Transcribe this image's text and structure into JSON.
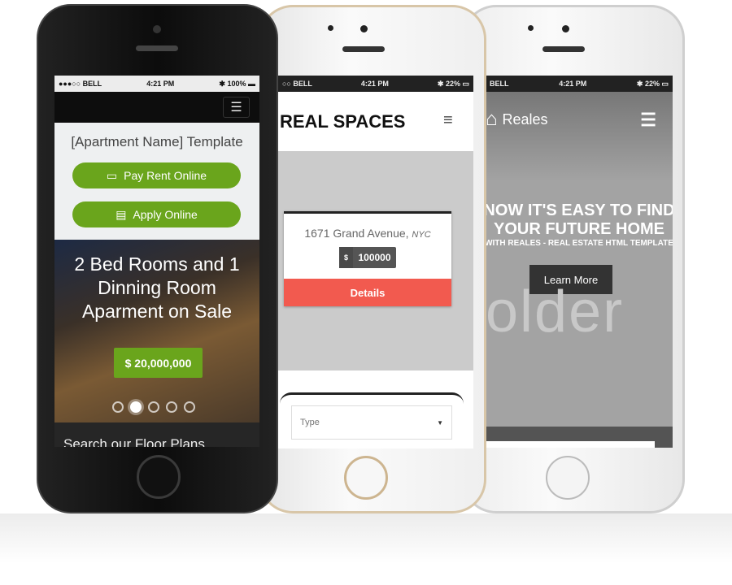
{
  "phone1": {
    "status": {
      "carrier": "●●●○○ BELL",
      "time": "4:21 PM",
      "battery": "100%"
    },
    "title": "[Apartment Name] Template",
    "pay_button": "Pay Rent Online",
    "apply_button": "Apply Online",
    "hero_text": "2 Bed Rooms and 1 Dinning Room Aparment on Sale",
    "price": "$ 20,000,000",
    "slider_dots": 5,
    "active_dot": 2,
    "floor_plans": "Search our Floor Plans",
    "accent": "#6aa51c"
  },
  "phone2": {
    "status": {
      "carrier": "○○ BELL",
      "time": "4:21 PM",
      "battery": "22%"
    },
    "logo": "REAL SPACES",
    "address": "1671 Grand Avenue,",
    "city": "NYC",
    "currency": "$",
    "price": "100000",
    "details_button": "Details",
    "type_select": "Type",
    "accent": "#f25a4f"
  },
  "phone3": {
    "status": {
      "carrier": "BELL",
      "time": "4:21 PM",
      "battery": "22%"
    },
    "logo": "Reales",
    "headline1": "NOW IT'S EASY TO FIND",
    "headline2": "YOUR FUTURE HOME",
    "subline": "WITH REALES - REAL ESTATE HTML TEMPLATE",
    "learn_more": "Learn More",
    "placeholder_text": "older"
  }
}
